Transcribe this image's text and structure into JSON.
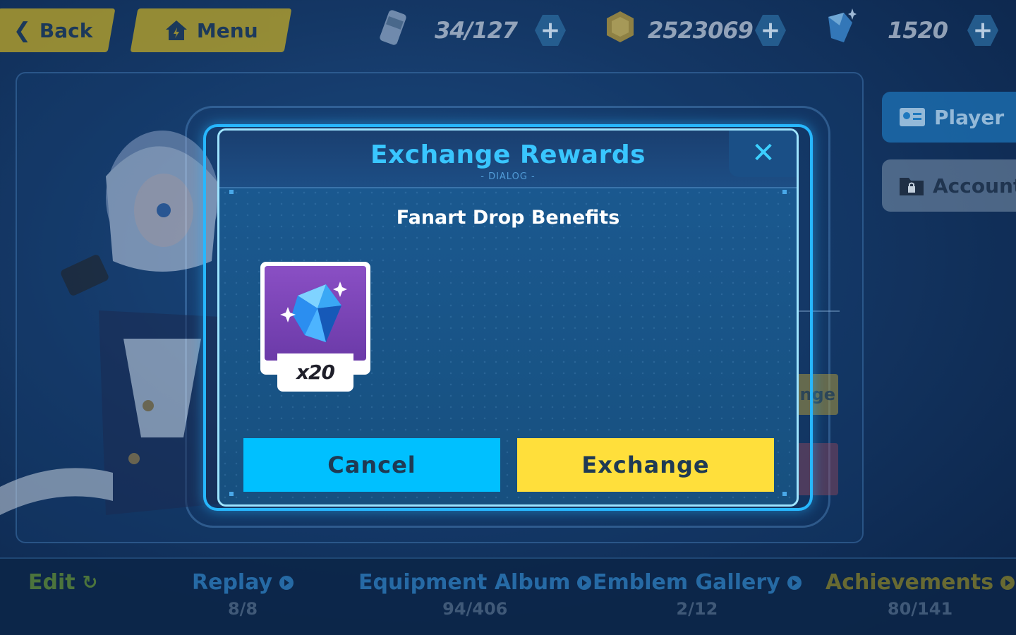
{
  "top_bar": {
    "back_label": "Back",
    "menu_label": "Menu",
    "stamina": "34/127",
    "gold": "2523069",
    "crystals": "1520"
  },
  "side_tabs": {
    "player": "Player",
    "account": "Account"
  },
  "background": {
    "partial_button_text": "ange"
  },
  "bottom_nav": {
    "items": [
      {
        "label": "Edit",
        "count": ""
      },
      {
        "label": "Replay",
        "count": "8/8"
      },
      {
        "label": "Equipment Album",
        "count": "94/406"
      },
      {
        "label": "Emblem Gallery",
        "count": "2/12"
      },
      {
        "label": "Achievements",
        "count": "80/141"
      }
    ]
  },
  "dialog": {
    "title": "Exchange Rewards",
    "tag": "- DIALOG -",
    "heading": "Fanart Drop Benefits",
    "reward": {
      "icon": "crystal-icon",
      "quantity": "x20"
    },
    "cancel_label": "Cancel",
    "exchange_label": "Exchange",
    "close_icon": "close-icon"
  },
  "colors": {
    "title_blue": "#39c6ff",
    "cancel_bg": "#00c0ff",
    "exchange_bg": "#ffdf3b",
    "reward_bg": "#7a45b8"
  }
}
